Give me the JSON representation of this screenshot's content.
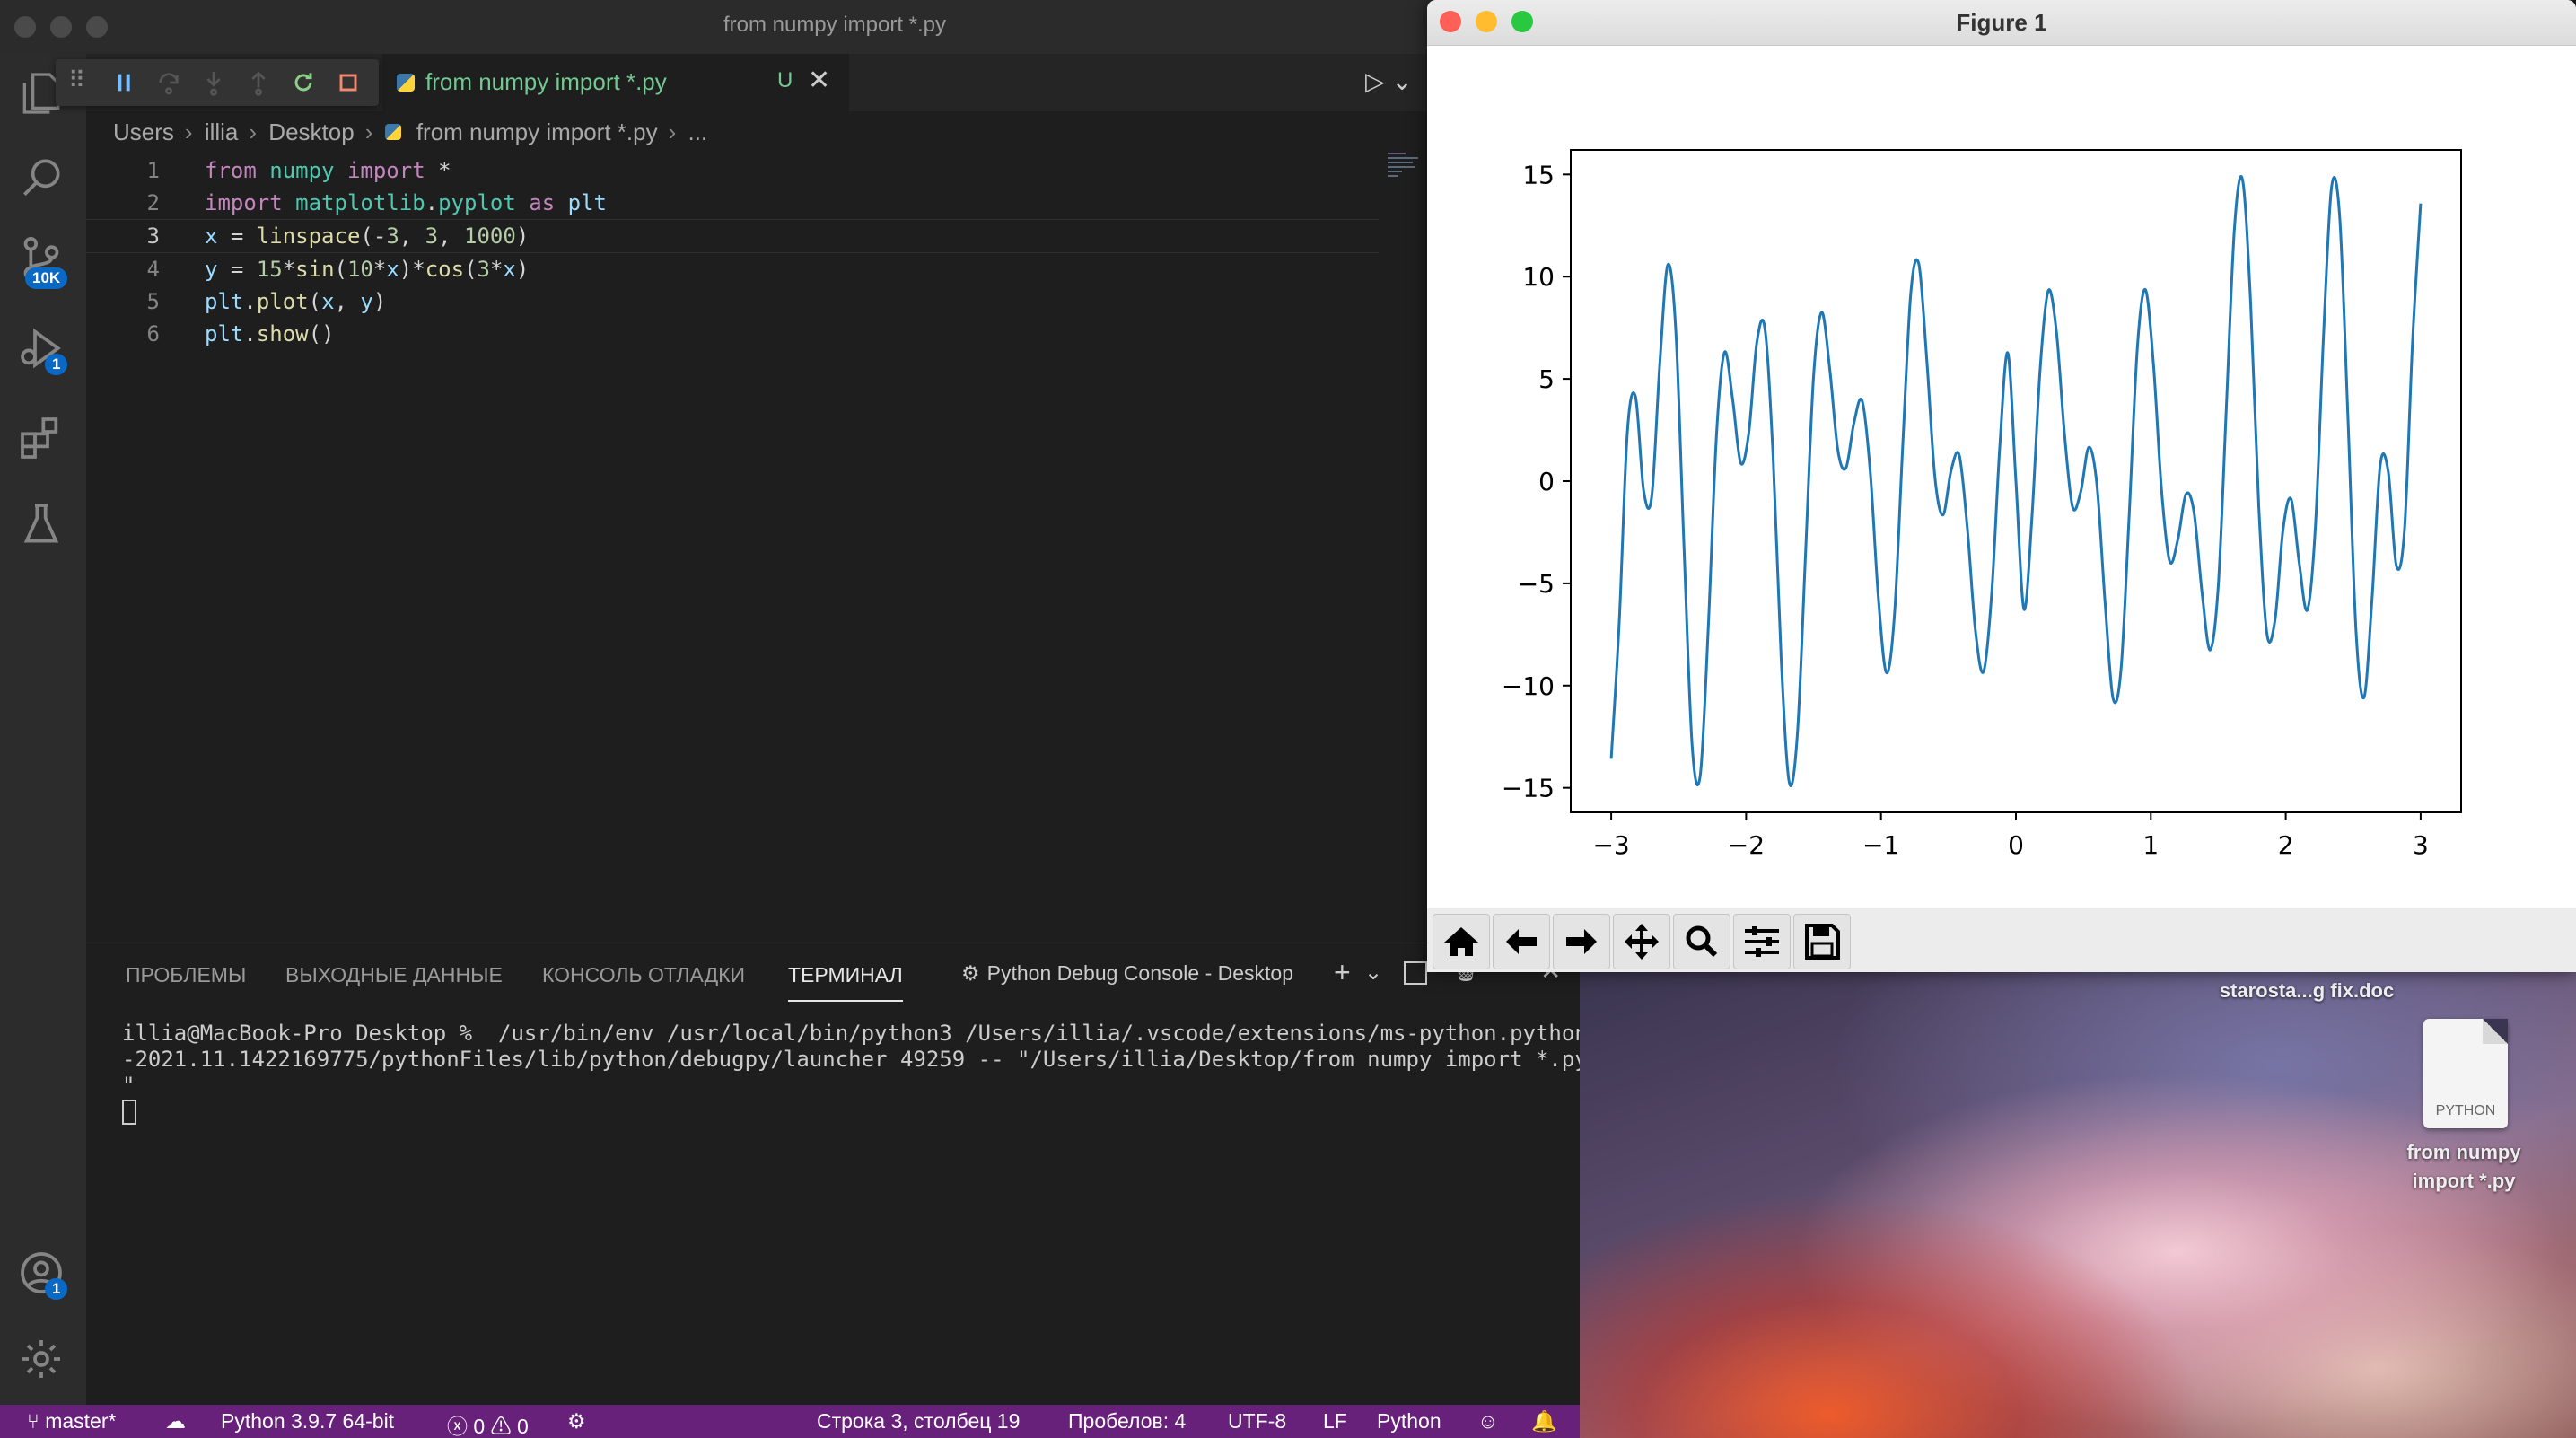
{
  "vscode": {
    "window_title": "from numpy import *.py",
    "tab": {
      "label": "from numpy import *.py",
      "modified": "U"
    },
    "breadcrumb": [
      "Users",
      "illia",
      "Desktop",
      "from numpy import *.py",
      "..."
    ],
    "activity_badges": {
      "source_control": "10K",
      "run_debug": "1",
      "accounts": "1"
    },
    "code_lines": [
      {
        "num": "1",
        "text": "from numpy import *"
      },
      {
        "num": "2",
        "text": "import matplotlib.pyplot as plt"
      },
      {
        "num": "3",
        "text": "x = linspace(-3, 3, 1000)"
      },
      {
        "num": "4",
        "text": "y = 15*sin(10*x)*cos(3*x)"
      },
      {
        "num": "5",
        "text": "plt.plot(x, y)"
      },
      {
        "num": "6",
        "text": "plt.show()"
      }
    ],
    "panel": {
      "tabs": [
        "ПРОБЛЕМЫ",
        "ВЫХОДНЫЕ ДАННЫЕ",
        "КОНСОЛЬ ОТЛАДКИ",
        "ТЕРМИНАЛ"
      ],
      "active_tab": "ТЕРМИНАЛ",
      "terminal_selector": "Python Debug Console - Desktop",
      "terminal_lines": [
        "illia@MacBook-Pro Desktop %  /usr/bin/env /usr/local/bin/python3 /Users/illia/.vscode/extensions/ms-python.python",
        "-2021.11.1422169775/pythonFiles/lib/python/debugpy/launcher 49259 -- \"/Users/illia/Desktop/from numpy import *.py",
        "\""
      ]
    },
    "statusbar": {
      "branch": "master*",
      "interpreter": "Python 3.9.7 64-bit",
      "errors": "0",
      "warnings": "0",
      "cursor_pos": "Строка 3, столбец 19",
      "indent": "Пробелов: 4",
      "encoding": "UTF-8",
      "eol": "LF",
      "language": "Python"
    }
  },
  "figure": {
    "window_title": "Figure 1",
    "toolbar": [
      "home-icon",
      "back-icon",
      "forward-icon",
      "pan-icon",
      "zoom-icon",
      "configure-subplots-icon",
      "save-icon"
    ]
  },
  "desktop": {
    "items": [
      {
        "label": "starosta...g fix.doc"
      },
      {
        "label_line1": "from numpy",
        "label_line2": "import *.py",
        "icon_text": "PYTHON"
      }
    ]
  },
  "chart_data": {
    "type": "line",
    "title": "",
    "xlabel": "",
    "ylabel": "",
    "xlim": [
      -3.3,
      3.3
    ],
    "ylim": [
      -16.2,
      16.2
    ],
    "xticks": [
      "−3",
      "−2",
      "−1",
      "0",
      "1",
      "2",
      "3"
    ],
    "yticks": [
      "15",
      "10",
      "5",
      "0",
      "−5",
      "−10",
      "−15"
    ],
    "grid": false,
    "color": "#1f77b4",
    "x": [
      -3.0,
      -2.94,
      -2.88,
      -2.82,
      -2.76,
      -2.7,
      -2.64,
      -2.58,
      -2.52,
      -2.46,
      -2.4,
      -2.34,
      -2.28,
      -2.22,
      -2.16,
      -2.1,
      -2.04,
      -1.98,
      -1.92,
      -1.86,
      -1.8,
      -1.74,
      -1.68,
      -1.62,
      -1.56,
      -1.5,
      -1.44,
      -1.38,
      -1.32,
      -1.26,
      -1.2,
      -1.14,
      -1.08,
      -1.02,
      -0.96,
      -0.9,
      -0.84,
      -0.78,
      -0.72,
      -0.66,
      -0.6,
      -0.54,
      -0.48,
      -0.42,
      -0.36,
      -0.3,
      -0.24,
      -0.18,
      -0.12,
      -0.06,
      0.0,
      0.06,
      0.12,
      0.18,
      0.24,
      0.3,
      0.36,
      0.42,
      0.48,
      0.54,
      0.6,
      0.66,
      0.72,
      0.78,
      0.84,
      0.9,
      0.96,
      1.02,
      1.08,
      1.14,
      1.2,
      1.26,
      1.32,
      1.38,
      1.44,
      1.5,
      1.56,
      1.62,
      1.68,
      1.74,
      1.8,
      1.86,
      1.92,
      1.98,
      2.04,
      2.1,
      2.16,
      2.22,
      2.28,
      2.34,
      2.4,
      2.46,
      2.52,
      2.58,
      2.64,
      2.7,
      2.76,
      2.82,
      2.88,
      2.94,
      3.0
    ],
    "y": [
      -13.58,
      -6.83,
      2.4,
      4.14,
      -0.46,
      -0.77,
      5.72,
      10.58,
      7.25,
      -3.33,
      -12.95,
      -14.39,
      -7.11,
      2.19,
      6.3,
      3.99,
      0.88,
      2.37,
      6.81,
      7.44,
      1.18,
      -8.71,
      -14.74,
      -12.39,
      -3.67,
      5.09,
      8.26,
      5.47,
      1.52,
      0.64,
      2.86,
      3.92,
      0.46,
      -5.67,
      -9.37,
      -6.53,
      1.57,
      9.15,
      10.63,
      5.87,
      0.17,
      -1.65,
      0.54,
      1.26,
      -2.32,
      -7.32,
      -9.32,
      -5.56,
      1.67,
      6.27,
      0.0,
      -6.27,
      -1.67,
      5.56,
      9.32,
      7.32,
      2.32,
      -1.26,
      -0.54,
      1.65,
      -0.17,
      -5.87,
      -10.63,
      -9.15,
      -1.57,
      6.53,
      9.37,
      5.67,
      -0.46,
      -3.92,
      -2.86,
      -0.64,
      -1.52,
      -5.47,
      -8.26,
      -5.09,
      3.67,
      12.39,
      14.74,
      8.71,
      -1.18,
      -7.44,
      -6.81,
      -2.37,
      -0.88,
      -3.99,
      -6.3,
      -2.19,
      7.11,
      14.39,
      12.95,
      3.33,
      -7.25,
      -10.58,
      -5.72,
      0.77,
      0.46,
      -4.14,
      -2.4,
      6.83,
      13.58
    ]
  }
}
